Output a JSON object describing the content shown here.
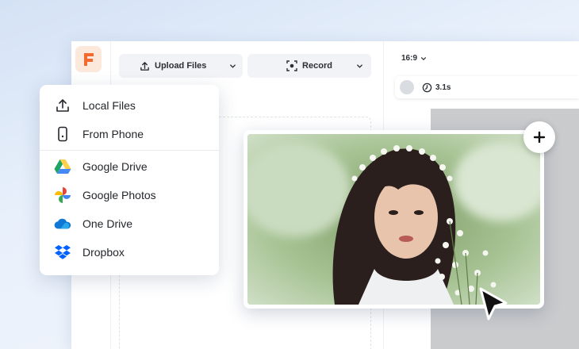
{
  "toolbar": {
    "upload_label": "Upload Files",
    "record_label": "Record",
    "ratio_label": "16:9",
    "duration_label": "3.1s"
  },
  "upload_menu": {
    "items": [
      {
        "label": "Local Files",
        "icon": "upload-icon"
      },
      {
        "label": "From Phone",
        "icon": "phone-icon"
      },
      {
        "label": "Google Drive",
        "icon": "google-drive-icon"
      },
      {
        "label": "Google Photos",
        "icon": "google-photos-icon"
      },
      {
        "label": "One Drive",
        "icon": "onedrive-icon"
      },
      {
        "label": "Dropbox",
        "icon": "dropbox-icon"
      }
    ]
  },
  "colors": {
    "brand": "#f26a2e",
    "drive_green": "#1fa463",
    "drive_yellow": "#ffd04b",
    "drive_blue": "#4688f4",
    "onedrive_blue": "#0f78d4",
    "dropbox_blue": "#0061fe"
  },
  "photo": {
    "description_icon": "portrait-photo"
  }
}
